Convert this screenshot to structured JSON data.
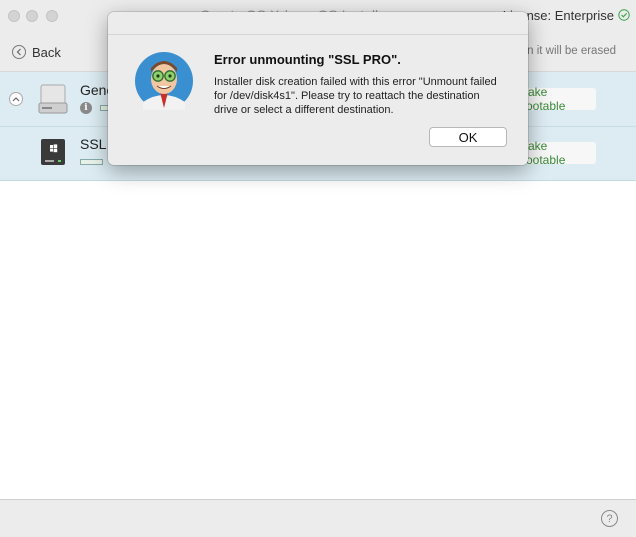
{
  "window": {
    "title": "Create OS X / macOS Install",
    "license": "License: Enterprise"
  },
  "toolbar": {
    "back_label": "Back",
    "erase_note": "All data on it will be erased"
  },
  "disks": [
    {
      "name": "Generic",
      "button": "Make Bootable",
      "icon": "hard-drive-icon"
    },
    {
      "name": "SSL PRO",
      "button": "Make Bootable",
      "icon": "windows-drive-icon"
    }
  ],
  "dialog": {
    "heading": "Error unmounting \"SSL PRO\".",
    "message": "Installer disk creation failed with this error \"Unmount failed for /dev/disk4s1\". Please try to reattach the destination drive or select a different destination.",
    "ok_label": "OK"
  },
  "footer": {
    "help_label": "?"
  },
  "colors": {
    "accent_green": "#3a8a3a",
    "selection_bg": "#dcecf2",
    "window_bg": "#ececec"
  }
}
